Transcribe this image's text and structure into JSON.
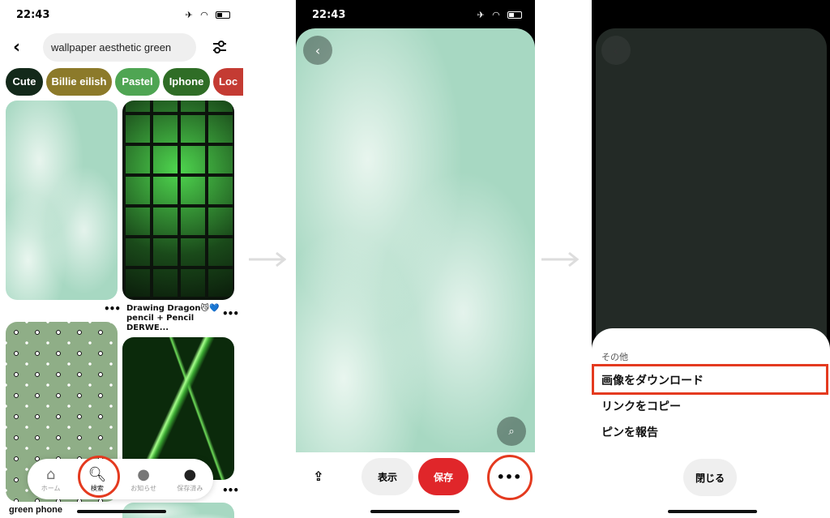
{
  "status": {
    "time": "22:43"
  },
  "search_screen": {
    "query": "wallpaper aesthetic green",
    "chips": [
      {
        "label": "Cute",
        "color": "#13291a"
      },
      {
        "label": "Billie eilish",
        "color": "#8c7a2a"
      },
      {
        "label": "Pastel",
        "color": "#4fa553"
      },
      {
        "label": "Iphone",
        "color": "#2f6d26"
      },
      {
        "label": "Loc",
        "color": "#c43b33"
      }
    ],
    "pins": [
      {
        "caption": ""
      },
      {
        "caption": "Drawing Dragon😼💙 pencil + Pencil DERWE..."
      },
      {
        "caption": "green phone"
      },
      {
        "caption": ""
      }
    ],
    "more": "•••",
    "nav": [
      {
        "label": "ホーム",
        "icon": "home-icon"
      },
      {
        "label": "検索",
        "icon": "search-icon"
      },
      {
        "label": "お知らせ",
        "icon": "chat-icon"
      },
      {
        "label": "保存済み",
        "icon": "avatar"
      }
    ]
  },
  "pin_screen": {
    "view_label": "表示",
    "save_label": "保存",
    "more": "•••",
    "save_color": "#e0262a"
  },
  "menu_screen": {
    "heading": "その他",
    "items": [
      "画像をダウンロード",
      "リンクをコピー",
      "ピンを報告"
    ],
    "close_label": "閉じる"
  },
  "highlight_color": "#e43a1f"
}
